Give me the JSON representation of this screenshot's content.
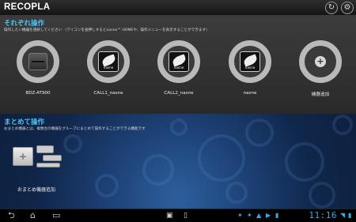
{
  "app": {
    "title": "RECOPLA"
  },
  "header": {
    "refresh_icon": "↻",
    "settings_icon": "⚙"
  },
  "section1": {
    "title": "それぞれ操作",
    "description": "操作したい機器を選択してください （アイコンを長押しするとnasne™ HOMEや、操作メニューを表示することができます）"
  },
  "devices": [
    {
      "label": "BDZ-AT900",
      "icon": "recorder-icon"
    },
    {
      "label": "CALL1_nasne",
      "icon": "nasne-icon",
      "brand": "nasne"
    },
    {
      "label": "CALL2_nasne",
      "icon": "nasne-icon",
      "brand": "nasne"
    },
    {
      "label": "nasne",
      "icon": "nasne-icon",
      "brand": "nasne"
    },
    {
      "label": "機器追加",
      "icon": "add-icon",
      "symbol": "+"
    }
  ],
  "section2": {
    "title": "まとめて操作",
    "description": "おまとめ機器とは、複数台の機器をグループにまとめて操作することができる機能です",
    "group_add_label": "おまとめ機器追加",
    "group_add_symbol": "+"
  },
  "navbar": {
    "back": "⮌",
    "home": "⌂",
    "recent": "▭",
    "time": "11:16"
  },
  "colors": {
    "accent": "#4ec3f0",
    "clock": "#36a9e6"
  }
}
